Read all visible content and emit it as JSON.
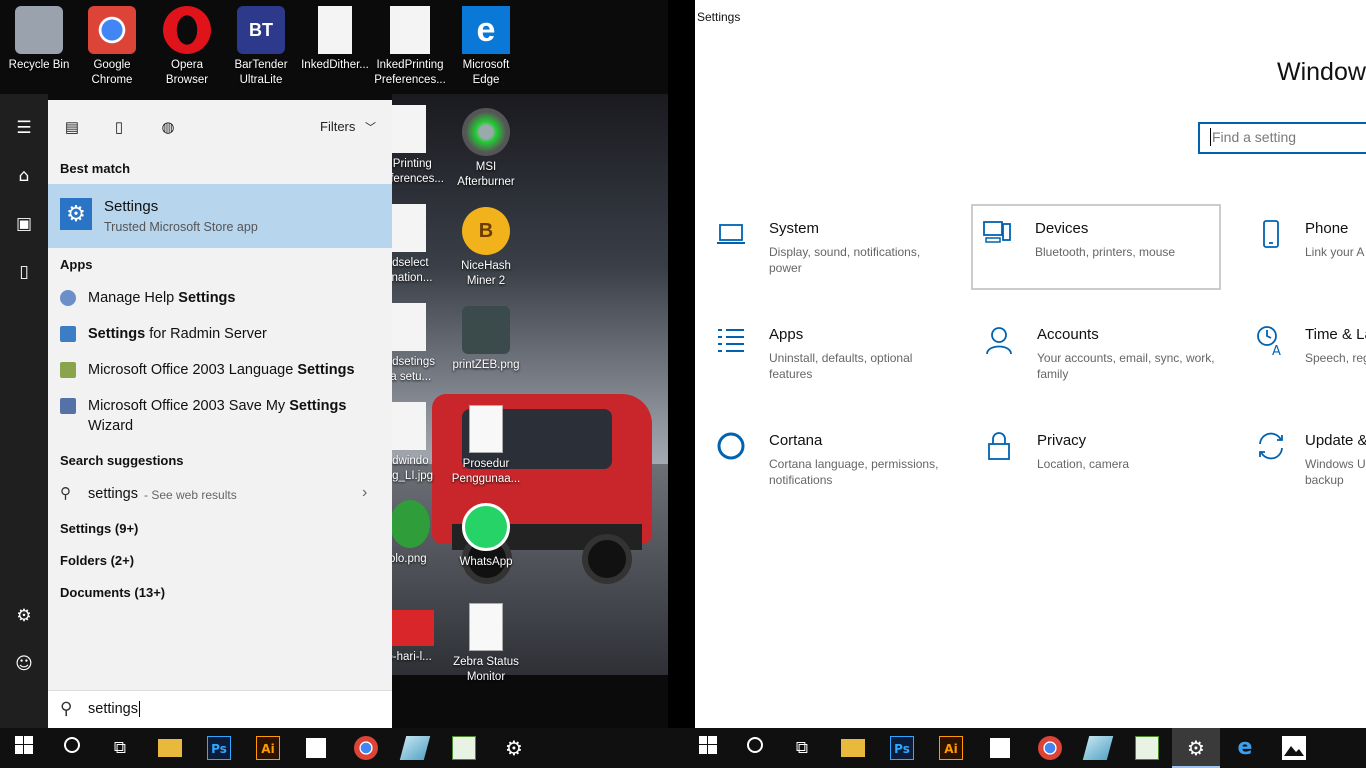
{
  "desktop": {
    "icons_top": [
      {
        "label": "Recycle Bin",
        "icon": "recycle-bin-icon",
        "color": "#9aa3ad"
      },
      {
        "label": "Google\nChrome",
        "icon": "chrome-icon",
        "color": "#e8eaed"
      },
      {
        "label": "Opera\nBrowser",
        "icon": "opera-icon",
        "color": "#e0131a"
      },
      {
        "label": "BarTender\nUltraLite",
        "icon": "bartender-icon",
        "color": "#2d3a8c"
      },
      {
        "label": "InkedDither...",
        "icon": "file-thumbnail-icon",
        "color": "#f4f4f4"
      },
      {
        "label": "InkedPrinting\nPreferences...",
        "icon": "file-thumbnail-icon",
        "color": "#f4f4f4"
      },
      {
        "label": "Microsoft\nEdge",
        "icon": "edge-icon",
        "color": "#0a78d7"
      }
    ],
    "icons_side": [
      {
        "label": "edPrinting\nreferences...",
        "icon": "file-thumbnail-icon"
      },
      {
        "label": "MSI\nAfterburner",
        "icon": "msi-afterburner-icon"
      },
      {
        "label": "kedselect\nstination...",
        "icon": "file-thumbnail-icon"
      },
      {
        "label": "NiceHash\nMiner 2",
        "icon": "nicehash-icon"
      },
      {
        "label": "kedsetings\nbra setu...",
        "icon": "file-thumbnail-icon"
      },
      {
        "label": "printZEB.png",
        "icon": "printer-icon"
      },
      {
        "label": "kedwindo\nting_LI.jpg",
        "icon": "file-thumbnail-icon"
      },
      {
        "label": "Prosedur\nPenggunaa...",
        "icon": "document-icon"
      },
      {
        "label": "alolo.png",
        "icon": "image-file-icon"
      },
      {
        "label": "WhatsApp",
        "icon": "whatsapp-icon"
      },
      {
        "label": "go-hari-l...",
        "icon": "image-file-icon"
      },
      {
        "label": "Zebra Status\nMonitor",
        "icon": "document-icon"
      }
    ]
  },
  "search": {
    "filters_label": "Filters",
    "best_match_header": "Best match",
    "best_match": {
      "title": "Settings",
      "subtitle": "Trusted Microsoft Store app"
    },
    "apps_header": "Apps",
    "apps": [
      {
        "pre": "Manage Help ",
        "bold": "Settings",
        "post": ""
      },
      {
        "pre": "",
        "bold": "Settings",
        "post": " for Radmin Server"
      },
      {
        "pre": "Microsoft Office 2003 Language ",
        "bold": "Settings",
        "post": ""
      },
      {
        "pre": "Microsoft Office 2003 Save My ",
        "bold": "Settings",
        "post": " Wizard"
      }
    ],
    "suggestions_header": "Search suggestions",
    "suggestion": {
      "term": "settings",
      "hint": " - See web results"
    },
    "groups": [
      "Settings (9+)",
      "Folders (2+)",
      "Documents (13+)"
    ],
    "query": "settings"
  },
  "settings_window": {
    "title": "Settings",
    "heading": "Windows",
    "search_placeholder": "Find a setting",
    "accent": "#0063b1",
    "tiles": [
      {
        "name": "System",
        "desc": "Display, sound, notifications, power",
        "icon": "laptop-icon"
      },
      {
        "name": "Devices",
        "desc": "Bluetooth, printers, mouse",
        "icon": "devices-icon"
      },
      {
        "name": "Phone",
        "desc": "Link your A",
        "icon": "phone-icon"
      },
      {
        "name": "Apps",
        "desc": "Uninstall, defaults, optional features",
        "icon": "apps-list-icon"
      },
      {
        "name": "Accounts",
        "desc": "Your accounts, email, sync, work, family",
        "icon": "person-icon"
      },
      {
        "name": "Time & La",
        "desc": "Speech, reg",
        "icon": "time-language-icon"
      },
      {
        "name": "Cortana",
        "desc": "Cortana language, permissions, notifications",
        "icon": "cortana-icon"
      },
      {
        "name": "Privacy",
        "desc": "Location, camera",
        "icon": "lock-icon"
      },
      {
        "name": "Update &",
        "desc": "Windows U backup",
        "icon": "update-icon"
      }
    ]
  },
  "taskbar_left": [
    "start-icon",
    "cortana-icon",
    "task-view-icon",
    "file-explorer-icon",
    "photoshop-icon",
    "illustrator-icon",
    "sticky-app-icon",
    "chrome-icon",
    "app-icon",
    "excel-chart-icon",
    "settings-gear-icon"
  ],
  "taskbar_right": [
    "start-icon",
    "cortana-icon",
    "task-view-icon",
    "file-explorer-icon",
    "photoshop-icon",
    "illustrator-icon",
    "sticky-app-icon",
    "chrome-icon",
    "app-icon",
    "excel-chart-icon",
    "settings-gear-icon",
    "internet-explorer-icon",
    "photos-icon"
  ]
}
